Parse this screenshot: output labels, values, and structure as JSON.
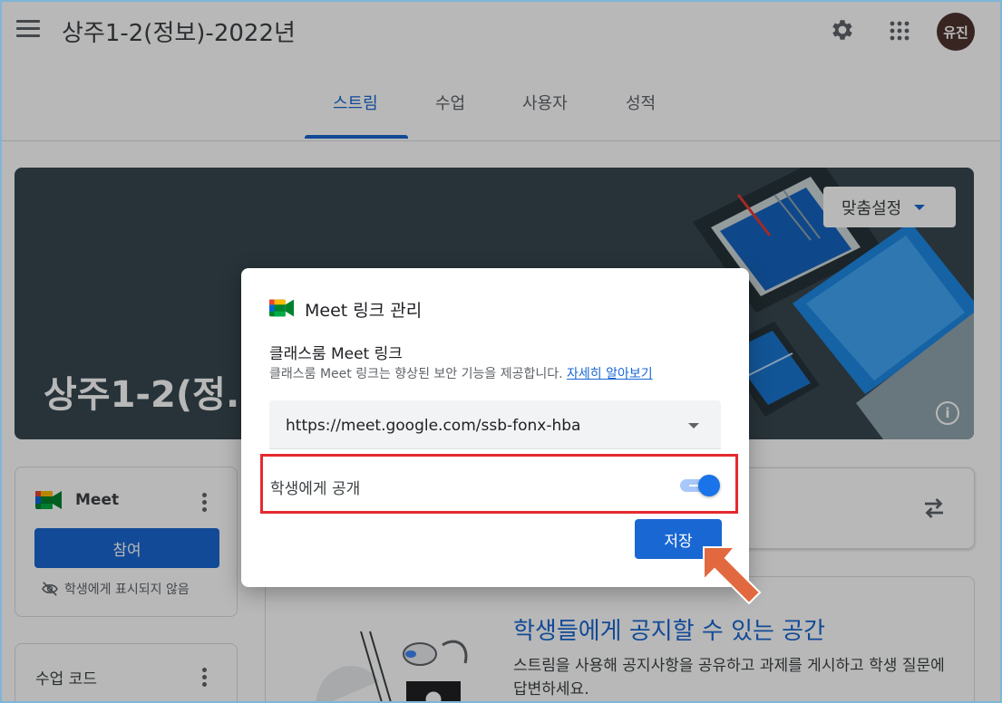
{
  "header": {
    "class_title": "상주1-2(정보)-2022년",
    "avatar_text": "유진"
  },
  "tabs": [
    {
      "label": "스트림",
      "active": true
    },
    {
      "label": "수업",
      "active": false
    },
    {
      "label": "사용자",
      "active": false
    },
    {
      "label": "성적",
      "active": false
    }
  ],
  "banner": {
    "title_visible": "상주1-2(정.",
    "customize_label": "맞춤설정"
  },
  "meet_card": {
    "title": "Meet",
    "join_label": "참여",
    "hidden_note": "학생에게 표시되지 않음"
  },
  "code_card": {
    "title": "수업 코드"
  },
  "announce_card": {
    "title": "학생들에게 공지할 수 있는 공간",
    "description": "스트림을 사용해 공지사항을 공유하고 과제를 게시하고 학생 질문에 답변하세요."
  },
  "dialog": {
    "title": "Meet 링크 관리",
    "subtitle": "클래스룸 Meet 링크",
    "description": "클래스룸 Meet 링크는 향상된 보안 기능을 제공합니다.",
    "learn_more": "자세히 알아보기",
    "link_value": "https://meet.google.com/ssb-fonx-hba",
    "public_label": "학생에게 공개",
    "public_enabled": true,
    "save_label": "저장"
  },
  "colors": {
    "accent": "#1967d2",
    "highlight_box": "#e52a2f",
    "pointer_arrow": "#e2693f",
    "banner_bg": "#37474f"
  }
}
